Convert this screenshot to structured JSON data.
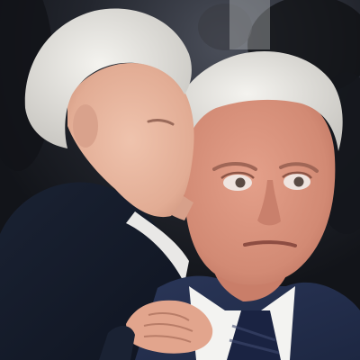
{
  "image": {
    "palette": {
      "background_dark": "#1b1d24",
      "suit_navy": "#1f2a44",
      "skin_left": "#e7b49d",
      "skin_right": "#d98f79",
      "hair_white": "#e9e7e2",
      "shirt_white": "#f3f3f1",
      "tie_navy": "#1a2342"
    }
  }
}
